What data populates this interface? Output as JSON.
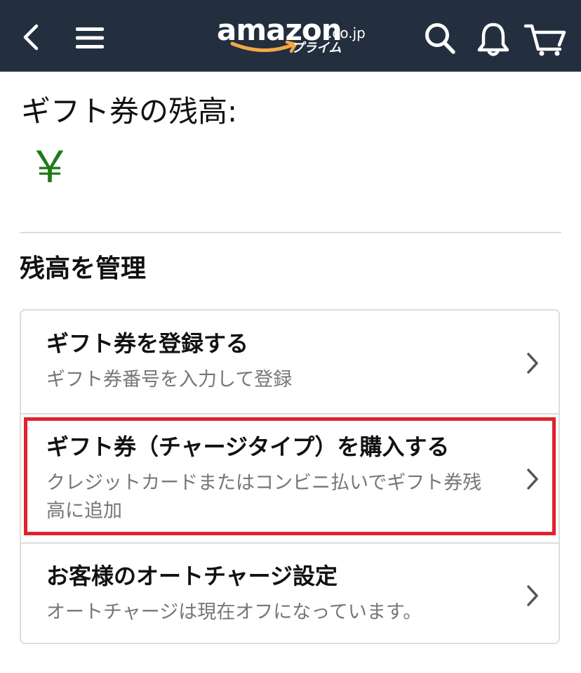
{
  "header": {
    "logo_word": "amazon",
    "logo_domain": ".co.jp",
    "logo_tagline": "プライム",
    "icons": [
      "back-icon",
      "menu-icon",
      "search-icon",
      "bell-icon",
      "cart-icon"
    ],
    "background_color": "#232f3e",
    "logo_smile_color": "#f3a847"
  },
  "balance": {
    "label": "ギフト券の残高:",
    "amount": "￥",
    "amount_color": "#1f7a1a"
  },
  "manage": {
    "title": "残高を管理",
    "items": [
      {
        "title": "ギフト券を登録する",
        "subtitle": "ギフト券番号を入力して登録",
        "highlighted": false
      },
      {
        "title": "ギフト券（チャージタイプ）を購入する",
        "subtitle": "クレジットカードまたはコンビニ払いでギフト券残高に追加",
        "highlighted": true
      },
      {
        "title": "お客様のオートチャージ設定",
        "subtitle": "オートチャージは現在オフになっています。",
        "highlighted": false
      }
    ],
    "highlight_color": "#e0222c"
  }
}
